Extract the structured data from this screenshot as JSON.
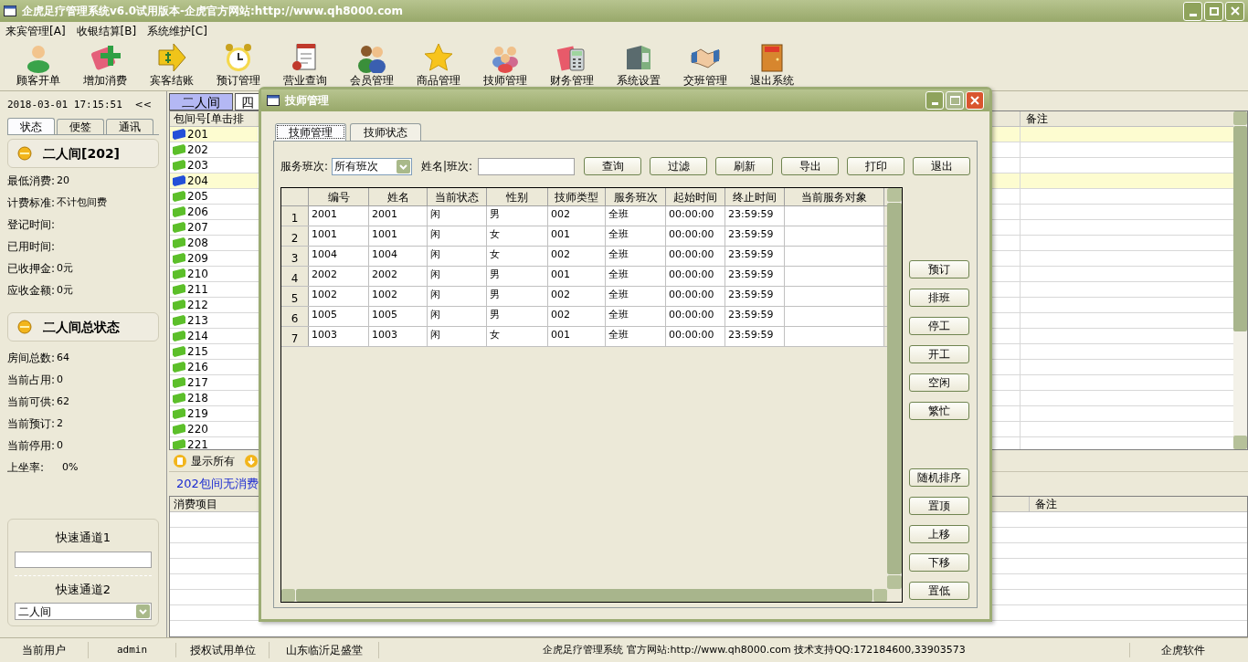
{
  "window": {
    "title": "企虎足疗管理系统v6.0试用版本-企虎官方网站:http://www.qh8000.com"
  },
  "menu": [
    "来宾管理[A]",
    "收银结算[B]",
    "系统维护[C]"
  ],
  "toolbar": [
    "顾客开单",
    "增加消费",
    "宾客结账",
    "预订管理",
    "营业查询",
    "会员管理",
    "商品管理",
    "技师管理",
    "财务管理",
    "系统设置",
    "交班管理",
    "退出系统"
  ],
  "left_panel": {
    "datetime": "2018-03-01 17:15:51",
    "collapse": "<<",
    "tabs": [
      {
        "label": "状态",
        "selected": true
      },
      {
        "label": "便签",
        "selected": false
      },
      {
        "label": "通讯",
        "selected": false
      }
    ],
    "room_group": {
      "title": "二人间[202]",
      "fields": [
        {
          "label": "最低消费:",
          "value": "20"
        },
        {
          "label": "计费标准:",
          "value": "不计包间费"
        },
        {
          "label": "登记时间:"
        },
        {
          "label": "已用时间:"
        },
        {
          "label": "已收押金:",
          "value": "0元"
        },
        {
          "label": "应收金额:",
          "value": "0元"
        }
      ]
    },
    "total_group": {
      "title": "二人间总状态",
      "fields": [
        {
          "label": "房间总数:",
          "value": "64"
        },
        {
          "label": "当前占用:",
          "value": "0"
        },
        {
          "label": "当前可供:",
          "value": "62"
        },
        {
          "label": "当前预订:",
          "value": "2"
        },
        {
          "label": "当前停用:",
          "value": "0"
        },
        {
          "label": "上坐率:",
          "value": "0%"
        }
      ]
    },
    "quick": {
      "label_1": "快速通道1",
      "label_2": "快速通道2",
      "select_value": "二人间"
    }
  },
  "room_tabs": [
    {
      "label": "二人间",
      "selected": true
    },
    {
      "label": "四",
      "selected": false
    }
  ],
  "room_table": {
    "columns": [
      "包间号[单击排",
      "备注"
    ],
    "rows": [
      {
        "number": "201",
        "reserved": true
      },
      {
        "number": "202",
        "reserved": false
      },
      {
        "number": "203",
        "reserved": false
      },
      {
        "number": "204",
        "reserved": true
      },
      {
        "number": "205",
        "reserved": false
      },
      {
        "number": "206",
        "reserved": false
      },
      {
        "number": "207",
        "reserved": false
      },
      {
        "number": "208",
        "reserved": false
      },
      {
        "number": "209",
        "reserved": false
      },
      {
        "number": "210",
        "reserved": false
      },
      {
        "number": "211",
        "reserved": false
      },
      {
        "number": "212",
        "reserved": false
      },
      {
        "number": "213",
        "reserved": false
      },
      {
        "number": "214",
        "reserved": false
      },
      {
        "number": "215",
        "reserved": false
      },
      {
        "number": "216",
        "reserved": false
      },
      {
        "number": "217",
        "reserved": false
      },
      {
        "number": "218",
        "reserved": false
      },
      {
        "number": "219",
        "reserved": false
      },
      {
        "number": "220",
        "reserved": false
      },
      {
        "number": "221",
        "reserved": false
      }
    ]
  },
  "show_all": "显示所有",
  "consumption_note": "202包间无消费",
  "consumption_table": {
    "columns": [
      "消费项目",
      "备注"
    ]
  },
  "status_bar": {
    "user_label": "当前用户",
    "user": "admin",
    "licensee_label": "授权试用单位",
    "licensee": "山东临沂足盛堂",
    "info": "企虎足疗管理系统 官方网站:http://www.qh8000.com 技术支持QQ:172184600,33903573",
    "vendor": "企虎软件"
  },
  "dialog": {
    "title": "技师管理",
    "tabs": [
      {
        "label": "技师管理",
        "selected": true
      },
      {
        "label": "技师状态",
        "selected": false
      }
    ],
    "shift_label": "服务班次:",
    "shift_value": "所有班次",
    "name_label": "姓名|班次:",
    "buttons": [
      "查询",
      "过滤",
      "刷新",
      "导出",
      "打印",
      "退出"
    ],
    "columns": [
      "编号",
      "姓名",
      "当前状态",
      "性别",
      "技师类型",
      "服务班次",
      "起始时间",
      "终止时间",
      "当前服务对象"
    ],
    "rows": [
      {
        "index": "1",
        "cells": [
          "2001",
          "2001",
          "闲",
          "男",
          "002",
          "全班",
          "00:00:00",
          "23:59:59",
          ""
        ]
      },
      {
        "index": "2",
        "cells": [
          "1001",
          "1001",
          "闲",
          "女",
          "001",
          "全班",
          "00:00:00",
          "23:59:59",
          ""
        ]
      },
      {
        "index": "3",
        "cells": [
          "1004",
          "1004",
          "闲",
          "女",
          "002",
          "全班",
          "00:00:00",
          "23:59:59",
          ""
        ]
      },
      {
        "index": "4",
        "cells": [
          "2002",
          "2002",
          "闲",
          "男",
          "001",
          "全班",
          "00:00:00",
          "23:59:59",
          ""
        ]
      },
      {
        "index": "5",
        "cells": [
          "1002",
          "1002",
          "闲",
          "男",
          "002",
          "全班",
          "00:00:00",
          "23:59:59",
          ""
        ]
      },
      {
        "index": "6",
        "cells": [
          "1005",
          "1005",
          "闲",
          "男",
          "002",
          "全班",
          "00:00:00",
          "23:59:59",
          ""
        ]
      },
      {
        "index": "7",
        "cells": [
          "1003",
          "1003",
          "闲",
          "女",
          "001",
          "全班",
          "00:00:00",
          "23:59:59",
          ""
        ]
      }
    ],
    "side_buttons_top": [
      "预订",
      "排班",
      "停工",
      "开工",
      "空闲",
      "繁忙"
    ],
    "side_buttons_bottom": [
      "随机排序",
      "置顶",
      "上移",
      "下移",
      "置低"
    ]
  }
}
